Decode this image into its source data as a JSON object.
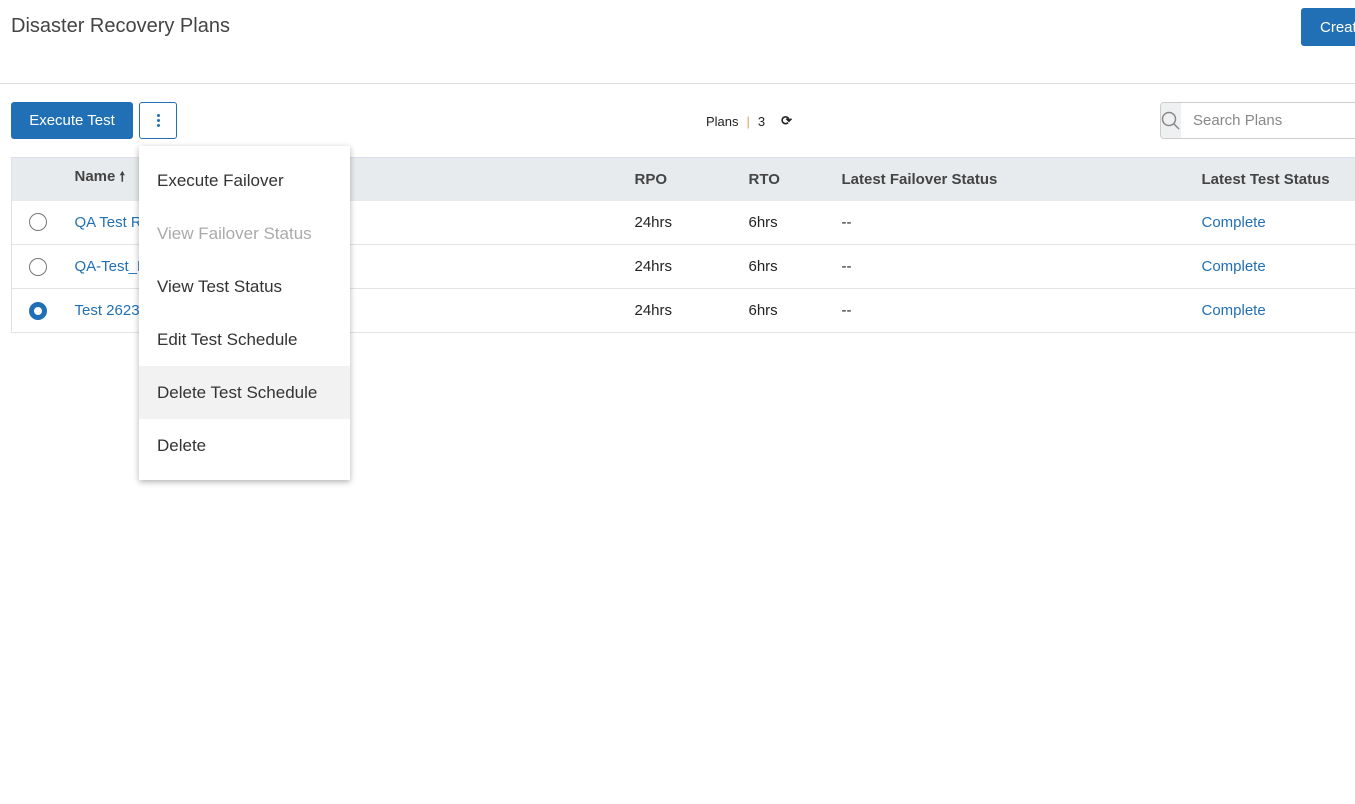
{
  "header": {
    "title": "Disaster Recovery Plans",
    "create_label": "Create"
  },
  "toolbar": {
    "execute_test_label": "Execute Test",
    "plans_label": "Plans",
    "plans_count": "3",
    "search_placeholder": "Search Plans"
  },
  "table": {
    "columns": [
      "Name",
      "RPO",
      "RTO",
      "Latest Failover Status",
      "Latest Test Status"
    ],
    "rows": [
      {
        "name": "QA Test R",
        "rpo": "24hrs",
        "rto": "6hrs",
        "failover": "--",
        "test": "Complete",
        "selected": false
      },
      {
        "name": "QA-Test_R",
        "rpo": "24hrs",
        "rto": "6hrs",
        "failover": "--",
        "test": "Complete",
        "selected": false
      },
      {
        "name": "Test 2623",
        "rpo": "24hrs",
        "rto": "6hrs",
        "failover": "--",
        "test": "Complete",
        "selected": true
      }
    ]
  },
  "menu": {
    "items": [
      {
        "label": "Execute Failover",
        "disabled": false
      },
      {
        "label": "View Failover Status",
        "disabled": true
      },
      {
        "label": "View Test Status",
        "disabled": false
      },
      {
        "label": "Edit Test Schedule",
        "disabled": false
      },
      {
        "label": "Delete Test Schedule",
        "disabled": false,
        "hovered": true
      },
      {
        "label": "Delete",
        "disabled": false
      }
    ]
  },
  "colors": {
    "accent": "#2170b5"
  }
}
